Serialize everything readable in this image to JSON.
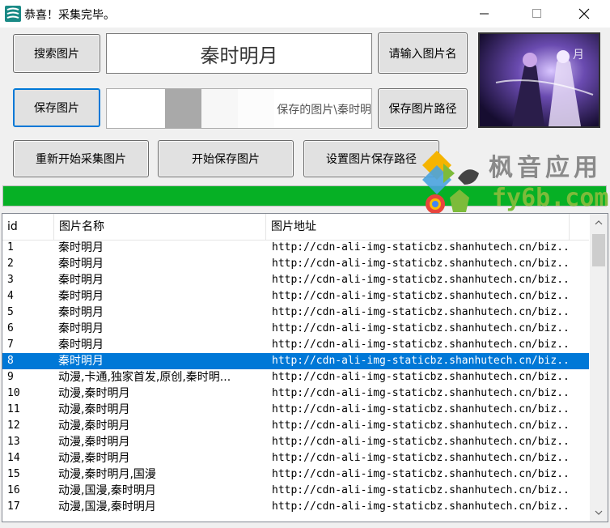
{
  "window": {
    "title": "恭喜！采集完毕。",
    "min_glyph": "—",
    "max_glyph": "☐",
    "close_glyph": "✕"
  },
  "toolbar": {
    "search_label": "搜索图片",
    "search_value": "秦时明月",
    "hint_label": "请输入图片名",
    "save_label": "保存图片",
    "path_text": "保存的图片\\秦时明",
    "save_path_label": "保存图片路径",
    "restart_label": "重新开始采集图片",
    "start_save_label": "开始保存图片",
    "set_path_label": "设置图片保存路径"
  },
  "progress": {
    "value": 1.0,
    "color": "#06b025"
  },
  "watermark": {
    "cn": "枫音应用",
    "url": "fy6b.com"
  },
  "table": {
    "headers": [
      "id",
      "图片名称",
      "图片地址"
    ],
    "selected_index": 7,
    "rows": [
      {
        "id": "1",
        "name": "秦时明月",
        "url": "http://cdn-ali-img-staticbz.shanhutech.cn/biz..."
      },
      {
        "id": "2",
        "name": "秦时明月",
        "url": "http://cdn-ali-img-staticbz.shanhutech.cn/biz..."
      },
      {
        "id": "3",
        "name": "秦时明月",
        "url": "http://cdn-ali-img-staticbz.shanhutech.cn/biz..."
      },
      {
        "id": "4",
        "name": "秦时明月",
        "url": "http://cdn-ali-img-staticbz.shanhutech.cn/biz..."
      },
      {
        "id": "5",
        "name": "秦时明月",
        "url": "http://cdn-ali-img-staticbz.shanhutech.cn/biz..."
      },
      {
        "id": "6",
        "name": "秦时明月",
        "url": "http://cdn-ali-img-staticbz.shanhutech.cn/biz..."
      },
      {
        "id": "7",
        "name": "秦时明月",
        "url": "http://cdn-ali-img-staticbz.shanhutech.cn/biz..."
      },
      {
        "id": "8",
        "name": "秦时明月",
        "url": "http://cdn-ali-img-staticbz.shanhutech.cn/biz..."
      },
      {
        "id": "9",
        "name": "动漫,卡通,独家首发,原创,秦时明...",
        "url": "http://cdn-ali-img-staticbz.shanhutech.cn/biz..."
      },
      {
        "id": "10",
        "name": "动漫,秦时明月",
        "url": "http://cdn-ali-img-staticbz.shanhutech.cn/biz..."
      },
      {
        "id": "11",
        "name": "动漫,秦时明月",
        "url": "http://cdn-ali-img-staticbz.shanhutech.cn/biz..."
      },
      {
        "id": "12",
        "name": "动漫,秦时明月",
        "url": "http://cdn-ali-img-staticbz.shanhutech.cn/biz..."
      },
      {
        "id": "13",
        "name": "动漫,秦时明月",
        "url": "http://cdn-ali-img-staticbz.shanhutech.cn/biz..."
      },
      {
        "id": "14",
        "name": "动漫,秦时明月",
        "url": "http://cdn-ali-img-staticbz.shanhutech.cn/biz..."
      },
      {
        "id": "15",
        "name": "动漫,秦时明月,国漫",
        "url": "http://cdn-ali-img-staticbz.shanhutech.cn/biz..."
      },
      {
        "id": "16",
        "name": "动漫,国漫,秦时明月",
        "url": "http://cdn-ali-img-staticbz.shanhutech.cn/biz..."
      },
      {
        "id": "17",
        "name": "动漫,国漫,秦时明月",
        "url": "http://cdn-ali-img-staticbz.shanhutech.cn/biz..."
      }
    ]
  }
}
